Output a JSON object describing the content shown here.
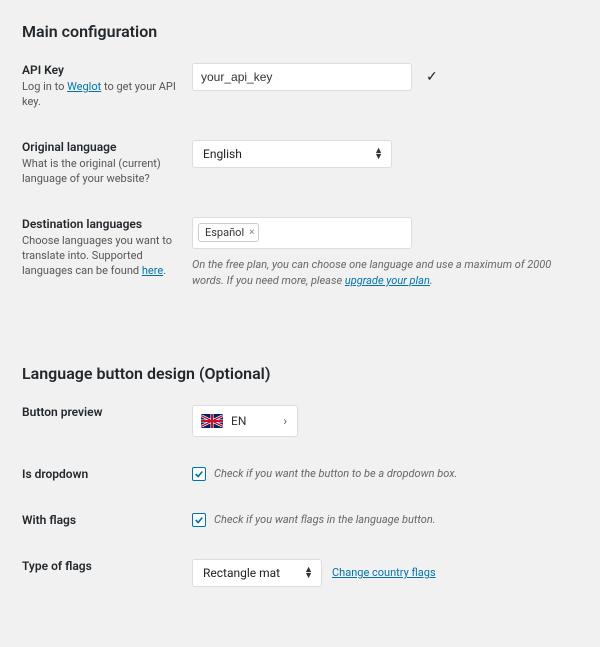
{
  "section1_title": "Main configuration",
  "api_key": {
    "label": "API Key",
    "desc_prefix": "Log in to ",
    "desc_link": "Weglot",
    "desc_suffix": " to get your API key.",
    "value": "your_api_key"
  },
  "original_lang": {
    "label": "Original language",
    "desc": "What is the original (current) language of your website?",
    "value": "English"
  },
  "dest_lang": {
    "label": "Destination languages",
    "desc_prefix": "Choose languages you want to translate into. Supported languages can be found ",
    "desc_link": "here",
    "desc_suffix": ".",
    "tag": "Español",
    "hint_prefix": "On the free plan, you can choose one language and use a maximum of 2000 words. If you need more, please ",
    "hint_link": "upgrade your plan",
    "hint_suffix": "."
  },
  "section2_title": "Language button design (Optional)",
  "preview": {
    "label": "Button preview",
    "code": "EN"
  },
  "is_dropdown": {
    "label": "Is dropdown",
    "desc": "Check if you want the button to be a dropdown box."
  },
  "with_flags": {
    "label": "With flags",
    "desc": "Check if you want flags in the language button."
  },
  "flag_type": {
    "label": "Type of flags",
    "value": "Rectangle mat",
    "change_link": "Change country flags"
  }
}
